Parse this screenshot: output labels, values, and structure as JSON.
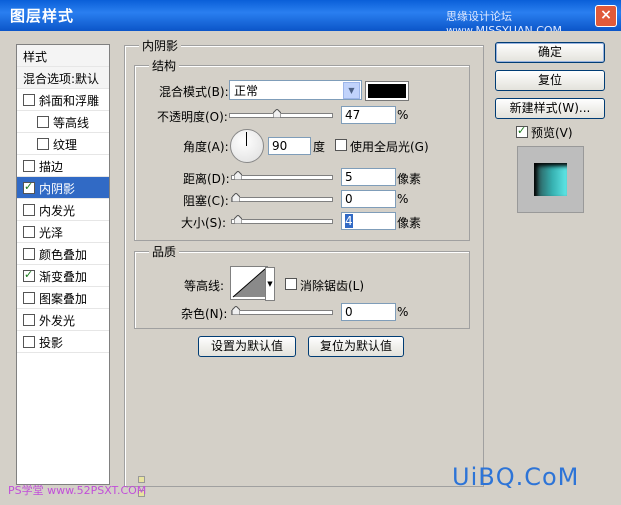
{
  "window": {
    "title": "图层样式",
    "watermark": "思缘设计论坛 www.MISSYUAN.COM",
    "close": "×"
  },
  "styles_list": {
    "header": "样式",
    "blend_options": "混合选项:默认",
    "items": [
      {
        "label": "斜面和浮雕",
        "checked": false
      },
      {
        "label": "等高线",
        "checked": false
      },
      {
        "label": "纹理",
        "checked": false
      },
      {
        "label": "描边",
        "checked": false
      },
      {
        "label": "内阴影",
        "checked": true,
        "selected": true
      },
      {
        "label": "内发光",
        "checked": false
      },
      {
        "label": "光泽",
        "checked": false
      },
      {
        "label": "颜色叠加",
        "checked": false
      },
      {
        "label": "渐变叠加",
        "checked": true
      },
      {
        "label": "图案叠加",
        "checked": false
      },
      {
        "label": "外发光",
        "checked": false
      },
      {
        "label": "投影",
        "checked": false
      }
    ]
  },
  "panel": {
    "title": "内阴影",
    "structure": {
      "title": "结构",
      "blend_mode_label": "混合模式(B):",
      "blend_mode_value": "正常",
      "shadow_color": "#000000",
      "opacity_label": "不透明度(O):",
      "opacity_value": "47",
      "opacity_unit": "%",
      "opacity_level": 0.47,
      "angle_label": "角度(A):",
      "angle_value": "90",
      "angle_unit": "度",
      "global_light_label": "使用全局光(G)",
      "global_light_checked": false,
      "distance_label": "距离(D):",
      "distance_value": "5",
      "distance_unit": "像素",
      "choke_label": "阻塞(C):",
      "choke_value": "0",
      "choke_unit": "%",
      "size_label": "大小(S):",
      "size_value": "4",
      "size_unit": "像素"
    },
    "quality": {
      "title": "品质",
      "contour_label": "等高线:",
      "anti_alias_label": "消除锯齿(L)",
      "anti_alias_checked": false,
      "noise_label": "杂色(N):",
      "noise_value": "0",
      "noise_unit": "%"
    },
    "make_default": "设置为默认值",
    "reset_default": "复位为默认值"
  },
  "buttons": {
    "ok": "确定",
    "reset": "复位",
    "new_style": "新建样式(W)...",
    "preview_label": "预览(V)",
    "preview_checked": true
  },
  "footer": {
    "left_watermark": "PS学堂 www.52PSXT.COM",
    "right_watermark": "UiBQ.CoM"
  }
}
